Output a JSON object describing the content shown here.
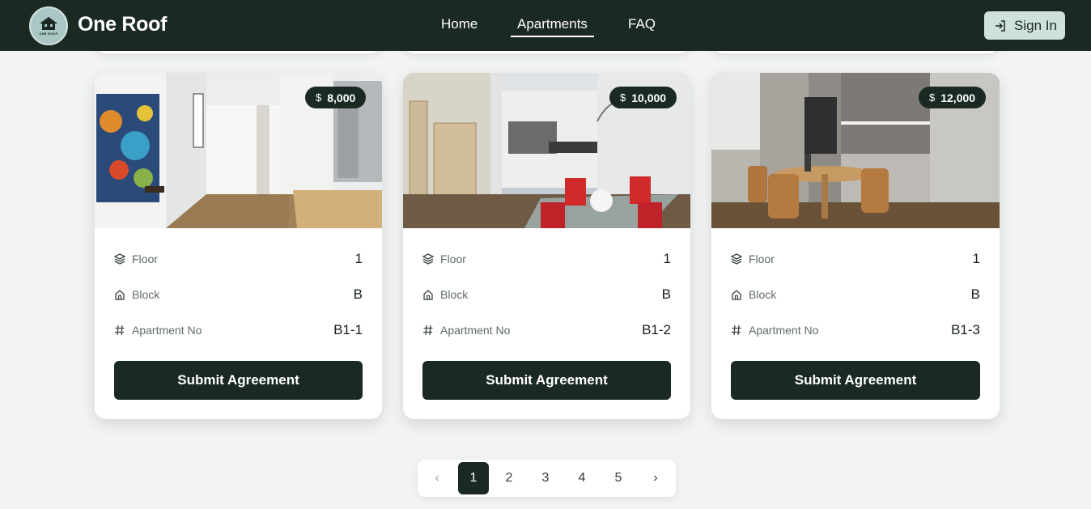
{
  "header": {
    "brand": "One Roof",
    "logo_text": "ONE ROOF",
    "nav": [
      {
        "label": "Home"
      },
      {
        "label": "Apartments"
      },
      {
        "label": "FAQ"
      }
    ],
    "active_nav": "Apartments",
    "signin_label": "Sign In"
  },
  "cards": [
    {
      "price_symbol": "$",
      "price": "8,000",
      "floor_label": "Floor",
      "floor": "1",
      "block_label": "Block",
      "block": "B",
      "apt_label": "Apartment No",
      "apt": "B1-1",
      "button": "Submit Agreement"
    },
    {
      "price_symbol": "$",
      "price": "10,000",
      "floor_label": "Floor",
      "floor": "1",
      "block_label": "Block",
      "block": "B",
      "apt_label": "Apartment No",
      "apt": "B1-2",
      "button": "Submit Agreement"
    },
    {
      "price_symbol": "$",
      "price": "12,000",
      "floor_label": "Floor",
      "floor": "1",
      "block_label": "Block",
      "block": "B",
      "apt_label": "Apartment No",
      "apt": "B1-3",
      "button": "Submit Agreement"
    }
  ],
  "pagination": {
    "prev": "‹",
    "pages": [
      "1",
      "2",
      "3",
      "4",
      "5"
    ],
    "current": "1",
    "next": "›"
  },
  "icons": {
    "floor": "layers-icon",
    "block": "home-icon",
    "apartment": "hash-icon",
    "signin": "sign-in-icon"
  },
  "colors": {
    "primary": "#1b2923",
    "accent_light": "#cfe1dd",
    "background": "#f1f4f3"
  }
}
